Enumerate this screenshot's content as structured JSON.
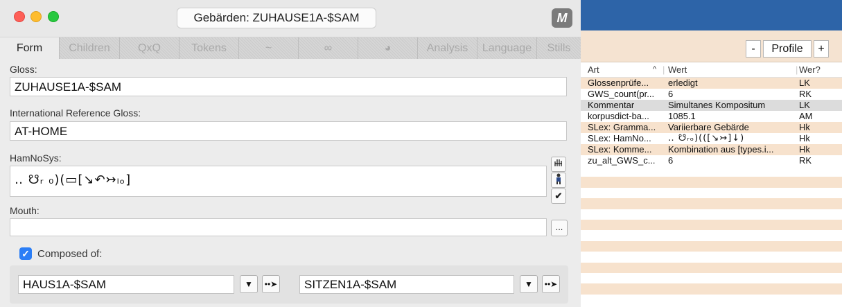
{
  "window": {
    "title": "Gebärden: ZUHAUSE1A-$SAM",
    "m_button": "M"
  },
  "tabs": [
    {
      "label": "Form"
    },
    {
      "label": "Children"
    },
    {
      "label": "QxQ"
    },
    {
      "label": "Tokens"
    },
    {
      "label": "~"
    },
    {
      "label": "∞"
    },
    {
      "label": "◕"
    },
    {
      "label": "Analysis"
    },
    {
      "label": "Language"
    },
    {
      "label": "Stills"
    }
  ],
  "form": {
    "gloss_label": "Gloss:",
    "gloss_value": "ZUHAUSE1A-$SAM",
    "irg_label": "International Reference Gloss:",
    "irg_value": "AT-HOME",
    "hamnosys_label": "HamNoSys:",
    "hamnosys_value": "‥ ☋ᵣ ₀)(▭[↘↶↣ₗₒ]",
    "mouth_label": "Mouth:",
    "mouth_value": "",
    "mouth_more": "...",
    "composed_label": "Composed of:",
    "composed_checked": true,
    "composed_1": "HAUS1A-$SAM",
    "composed_2": "SITZEN1A-$SAM",
    "side_icons": [
      "hand-icon",
      "person-icon",
      "checkmark-icon"
    ]
  },
  "profile": {
    "minus": "-",
    "label": "Profile",
    "plus": "+",
    "columns": {
      "art": "Art",
      "wert": "Wert",
      "wer": "Wer?"
    },
    "rows": [
      {
        "art": "Glossenprüfe...",
        "wert": "erledigt",
        "wer": "LK",
        "bg": "#f7e2cd"
      },
      {
        "art": "GWS_count(pr...",
        "wert": "6",
        "wer": "RK",
        "bg": "#ffffff"
      },
      {
        "art": "Kommentar",
        "wert": "Simultanes Kompositum",
        "wer": "LK",
        "bg": "#dcdcdc"
      },
      {
        "art": "korpusdict-ba...",
        "wert": "1085.1",
        "wer": "AM",
        "bg": "#ffffff"
      },
      {
        "art": "SLex: Gramma...",
        "wert": "Variierbare Gebärde",
        "wer": "Hk",
        "bg": "#f7e2cd"
      },
      {
        "art": "SLex: HamNo...",
        "wert": "‥ ☋ᵣₒ)(([↘↣]↓)",
        "wer": "Hk",
        "bg": "#ffffff"
      },
      {
        "art": "SLex: Komme...",
        "wert": "Kombination aus [types.i...",
        "wer": "Hk",
        "bg": "#f7e2cd"
      },
      {
        "art": "zu_alt_GWS_c...",
        "wert": "6",
        "wer": "RK",
        "bg": "#ffffff"
      }
    ],
    "colors": {
      "stripe": "#f7e2cd",
      "title_bar": "#2d64a8"
    }
  }
}
